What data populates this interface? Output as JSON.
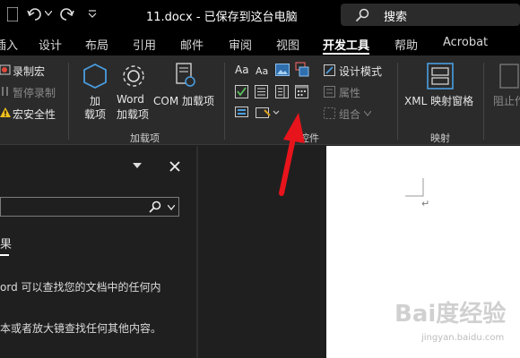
{
  "titlebar": {
    "doc_title": "11.docx - 已保存到这台电脑",
    "search_placeholder": "搜索",
    "undo_icon": "undo-icon",
    "redo_icon": "redo-icon",
    "save_icon": "save-icon",
    "customize_icon": "customize-qat-icon"
  },
  "tabs": [
    "插入",
    "设计",
    "布局",
    "引用",
    "邮件",
    "审阅",
    "视图",
    "开发工具",
    "帮助",
    "Acrobat"
  ],
  "active_tab": "开发工具",
  "ribbon": {
    "code_group": {
      "record_macro": "录制宏",
      "pause_recording": "暂停录制",
      "macro_security": "宏安全性"
    },
    "addins_group": {
      "name": "加载项",
      "addins_line1": "加",
      "addins_line2": "载项",
      "word_addins_line1": "Word",
      "word_addins_line2": "加载项",
      "com_addins": "COM 加载项"
    },
    "controls_group": {
      "name": "控件",
      "rich_text_aa": "Aa",
      "plain_text_aa": "Aa",
      "design_mode": "设计模式",
      "properties": "属性",
      "group": "组合"
    },
    "mapping_group": {
      "name": "映射",
      "xml_mapping": "XML 映射窗格"
    },
    "protect_group": {
      "block": "阻止作"
    }
  },
  "pane": {
    "tab_label": "果",
    "text1": "ord 可以查找您的文档中的任何内",
    "text2": "本或者放大镜查找任何其他内容。",
    "dropdown_icon": "pane-options-icon",
    "close_icon": "close-icon",
    "search_icon": "search-icon"
  },
  "document": {
    "paragraph_mark": "↵"
  },
  "watermark": {
    "main": "Bai度经验",
    "sub": "jingyan.baidu.com"
  },
  "colors": {
    "annotation_arrow": "#e8141c",
    "titlebar_bg": "#000000",
    "ribbon_bg": "#2b2b2b",
    "accent_blue": "#4a9ee0"
  }
}
